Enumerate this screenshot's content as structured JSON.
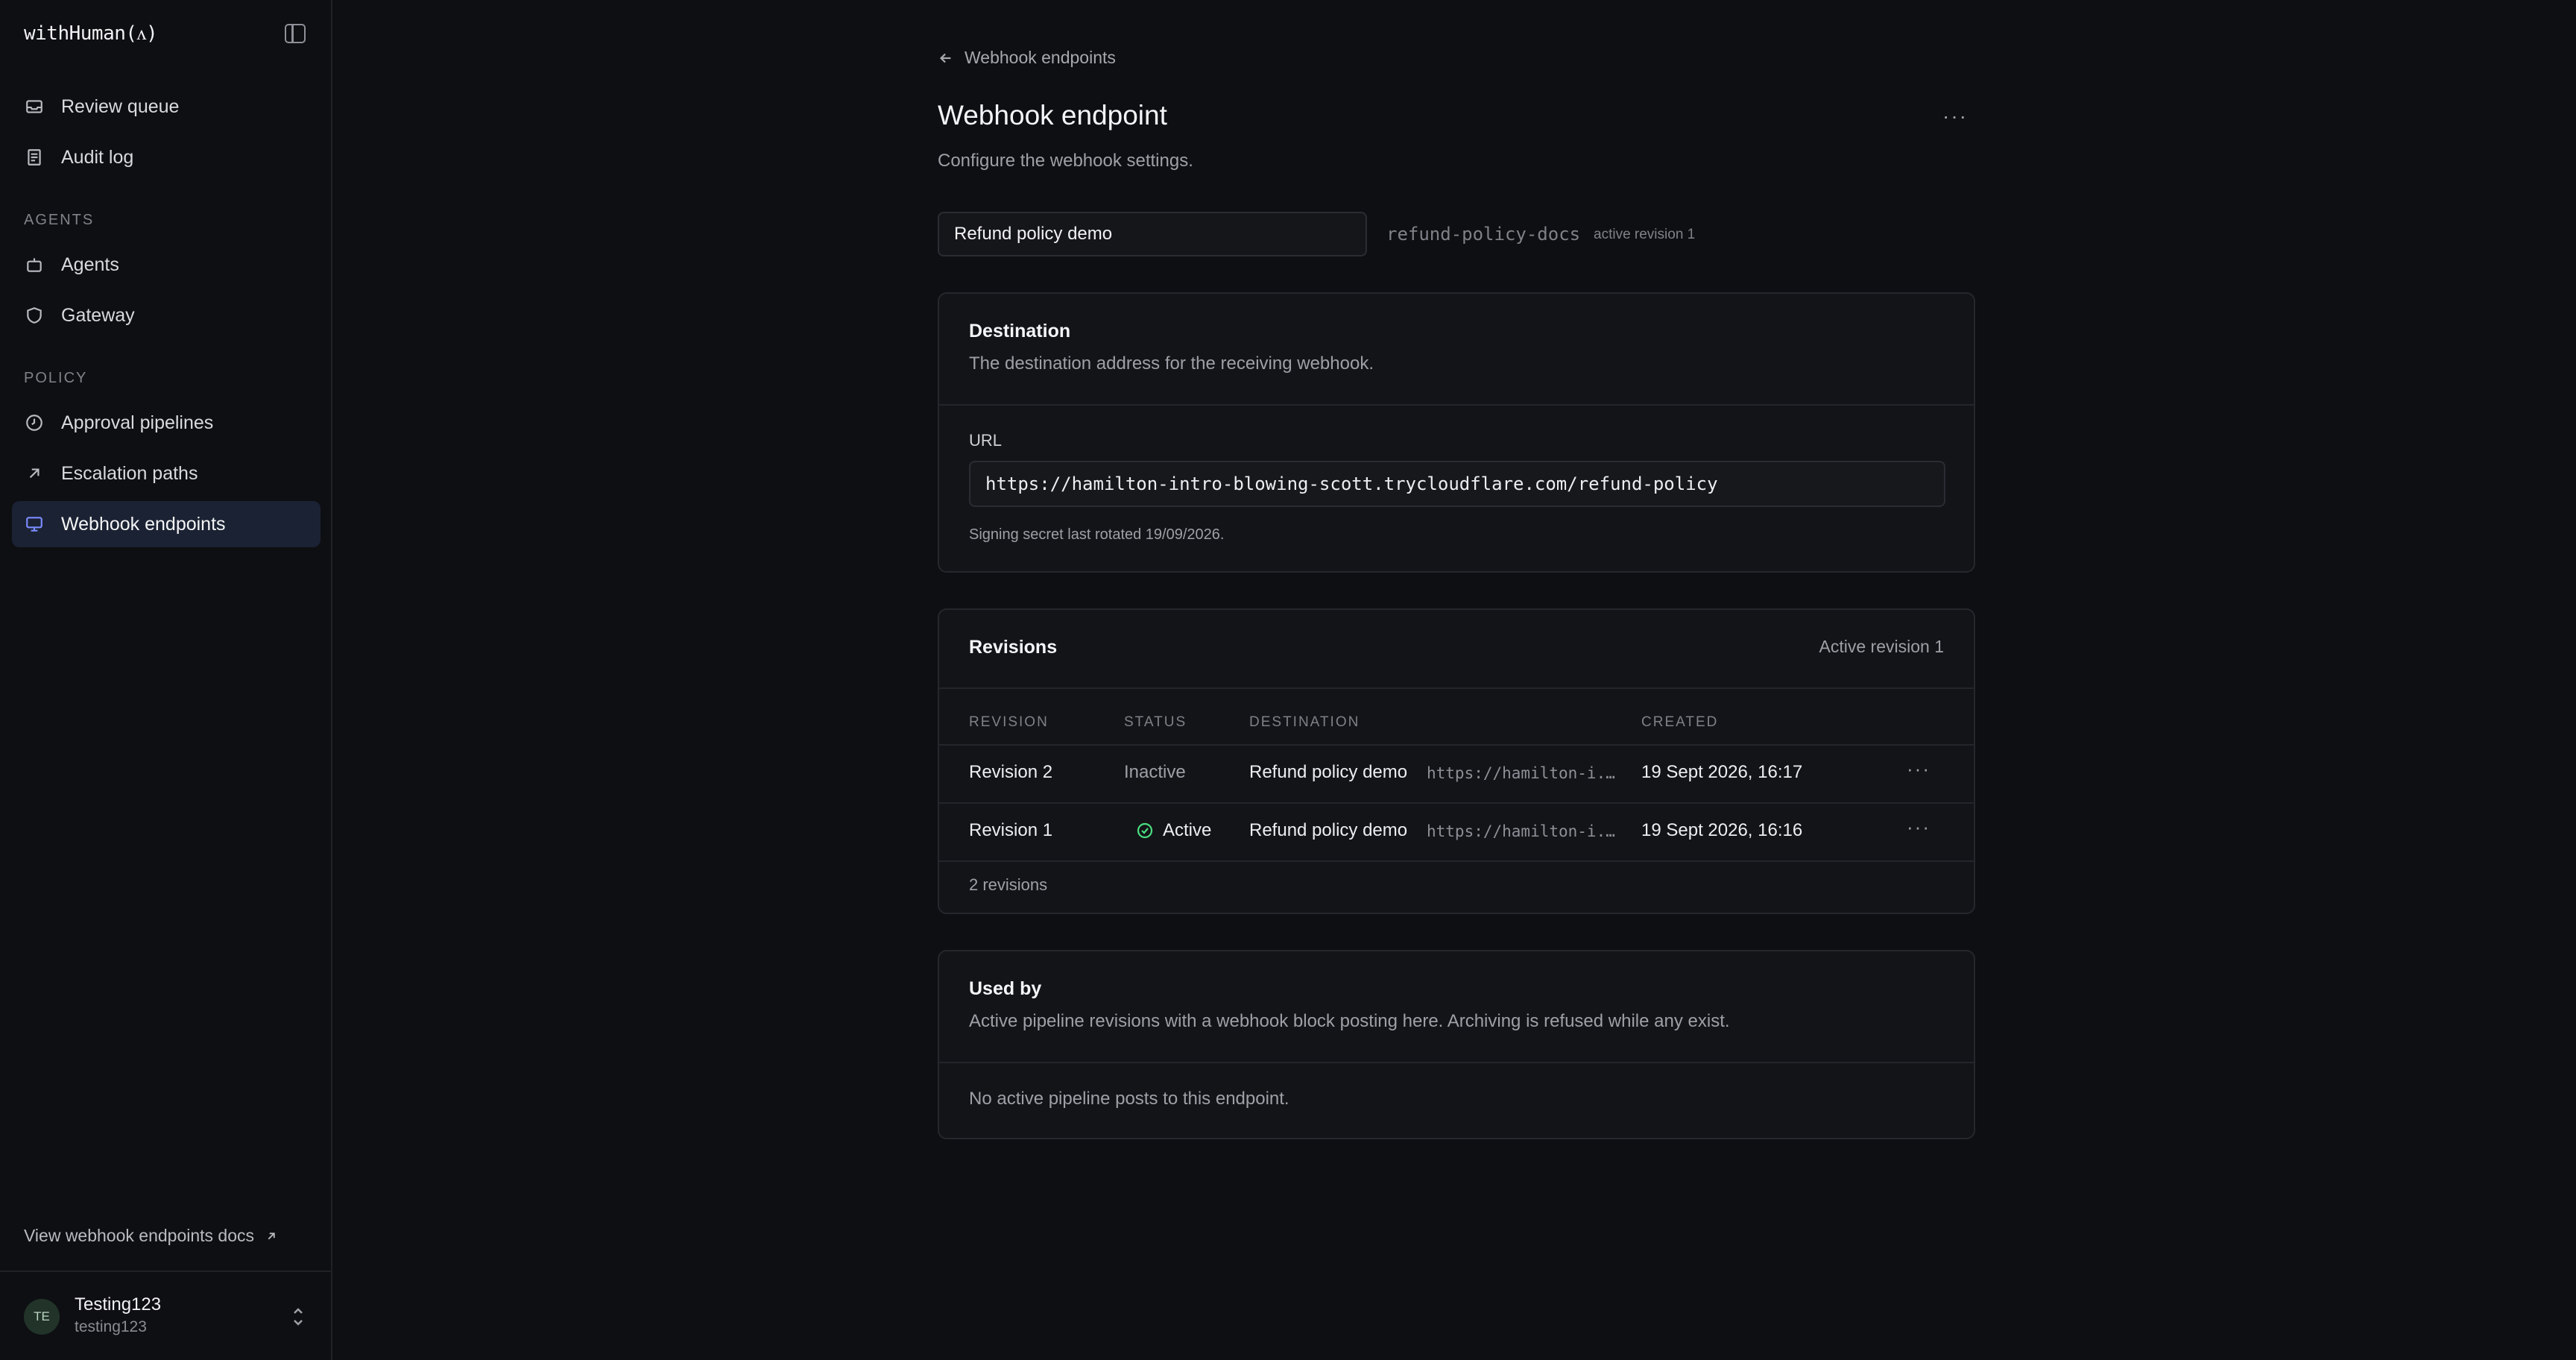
{
  "app": {
    "brand": "withHuman(ᴧ)"
  },
  "sidebar": {
    "items": [
      {
        "label": "Review queue",
        "icon": "inbox-icon"
      },
      {
        "label": "Audit log",
        "icon": "document-icon"
      }
    ],
    "sections": [
      {
        "label": "AGENTS",
        "items": [
          {
            "label": "Agents",
            "icon": "bot-icon"
          },
          {
            "label": "Gateway",
            "icon": "shield-icon"
          }
        ]
      },
      {
        "label": "POLICY",
        "items": [
          {
            "label": "Approval pipelines",
            "icon": "clock-icon"
          },
          {
            "label": "Escalation paths",
            "icon": "arrow-up-right-icon"
          },
          {
            "label": "Webhook endpoints",
            "icon": "monitor-icon",
            "active": true
          }
        ]
      }
    ],
    "docs_link": "View webhook endpoints docs",
    "user": {
      "initials": "TE",
      "name": "Testing123",
      "handle": "testing123"
    }
  },
  "breadcrumb": {
    "back_label": "Webhook endpoints"
  },
  "page": {
    "title": "Webhook endpoint",
    "subtitle": "Configure the webhook settings.",
    "name_value": "Refund policy demo",
    "slug": "refund-policy-docs",
    "revision_tag": "active revision 1"
  },
  "destination": {
    "title": "Destination",
    "description": "The destination address for the receiving webhook.",
    "url_label": "URL",
    "url_value": "https://hamilton-intro-blowing-scott.trycloudflare.com/refund-policy",
    "help": "Signing secret last rotated 19/09/2026."
  },
  "revisions": {
    "title": "Revisions",
    "active_label": "Active revision 1",
    "columns": [
      "REVISION",
      "STATUS",
      "DESTINATION",
      "CREATED"
    ],
    "rows": [
      {
        "revision": "Revision 2",
        "status": "Inactive",
        "dest_name": "Refund policy demo",
        "dest_url": "https://hamilton-i...",
        "created": "19 Sept 2026, 16:17"
      },
      {
        "revision": "Revision 1",
        "status": "Active",
        "dest_name": "Refund policy demo",
        "dest_url": "https://hamilton-i...",
        "created": "19 Sept 2026, 16:16"
      }
    ],
    "count_label": "2 revisions"
  },
  "used_by": {
    "title": "Used by",
    "description": "Active pipeline revisions with a webhook block posting here. Archiving is refused while any exist.",
    "empty": "No active pipeline posts to this endpoint."
  },
  "colors": {
    "accent": "#7b8cff",
    "active_nav_bg": "#1b2233",
    "success": "#4ade80"
  }
}
